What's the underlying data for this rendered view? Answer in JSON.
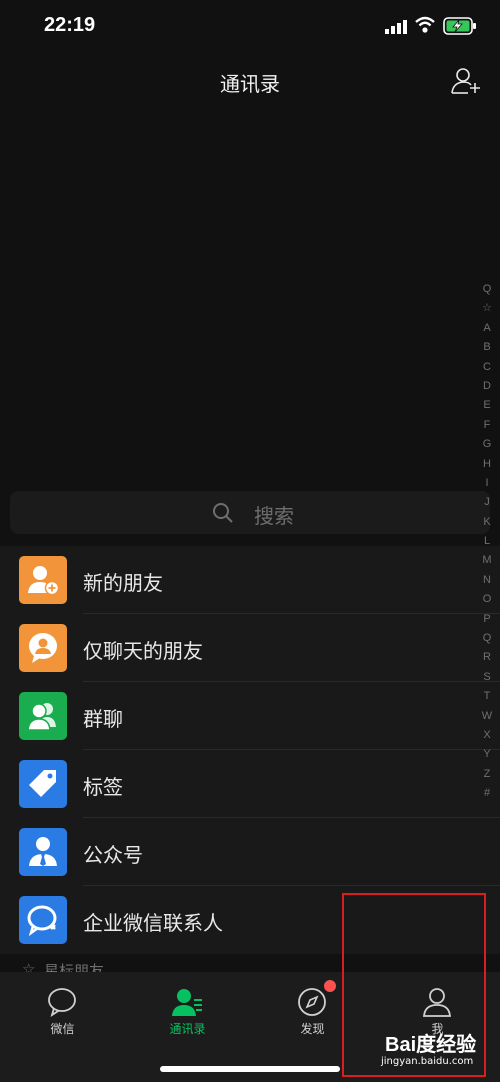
{
  "status": {
    "time": "22:19"
  },
  "nav": {
    "title": "通讯录"
  },
  "search": {
    "placeholder": "搜索"
  },
  "menu": [
    {
      "label": "新的朋友",
      "color": "#f2953a",
      "icon": "new-friend-icon"
    },
    {
      "label": "仅聊天的朋友",
      "color": "#f2953a",
      "icon": "chat-only-friend-icon"
    },
    {
      "label": "群聊",
      "color": "#1aad4f",
      "icon": "group-chat-icon"
    },
    {
      "label": "标签",
      "color": "#2b7be4",
      "icon": "tag-icon"
    },
    {
      "label": "公众号",
      "color": "#2b7be4",
      "icon": "official-account-icon"
    },
    {
      "label": "企业微信联系人",
      "color": "#2b7be4",
      "icon": "wecom-contact-icon"
    }
  ],
  "section": {
    "starred": "星标朋友"
  },
  "index": [
    "Q",
    "☆",
    "A",
    "B",
    "C",
    "D",
    "E",
    "F",
    "G",
    "H",
    "I",
    "J",
    "K",
    "L",
    "M",
    "N",
    "O",
    "P",
    "Q",
    "R",
    "S",
    "T",
    "W",
    "X",
    "Y",
    "Z",
    "#"
  ],
  "tabs": [
    {
      "label": "微信",
      "icon": "chat-icon"
    },
    {
      "label": "通讯录",
      "icon": "contacts-icon"
    },
    {
      "label": "发现",
      "icon": "discover-icon"
    },
    {
      "label": "我",
      "icon": "me-icon"
    }
  ],
  "watermark": {
    "logo": "Bai度经验",
    "url": "jingyan.baidu.com"
  },
  "colors": {
    "accent": "#07c160",
    "badge": "#fa5151",
    "highlight_box": "#d81e1e"
  }
}
